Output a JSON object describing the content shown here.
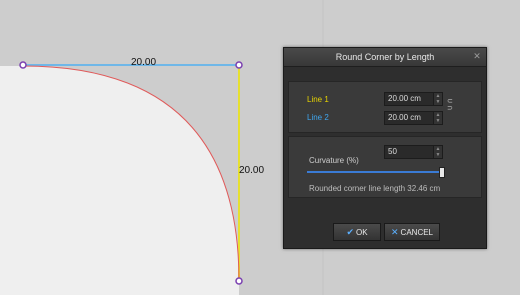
{
  "canvas": {
    "top_dimension": "20.00",
    "right_dimension": "20.00",
    "colors": {
      "background": "#cfcfcf",
      "shape_fill": "#efefef",
      "line1": "#e6e030",
      "line2": "#6fb7e8",
      "arc": "#e05a5a",
      "node": "#7a3fb0"
    }
  },
  "dialog": {
    "title": "Round Corner by Length",
    "close_icon": "close-icon",
    "line1": {
      "label": "Line 1",
      "value": "20.00 cm",
      "color": "#e6d300"
    },
    "line2": {
      "label": "Line 2",
      "value": "20.00 cm",
      "color": "#3fa6ef"
    },
    "link_icon": "chain-link-icon",
    "curvature": {
      "label": "Curvature (%)",
      "value": "50",
      "slider_fraction": 1.0
    },
    "info": "Rounded corner line length  32.46 cm",
    "ok_label": "OK",
    "cancel_label": "CANCEL"
  }
}
